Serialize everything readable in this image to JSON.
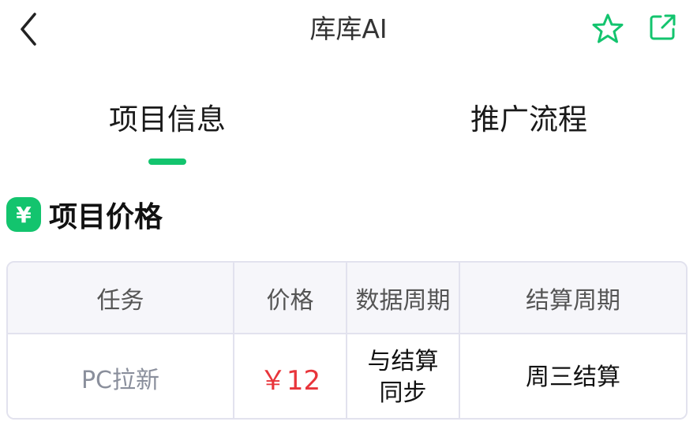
{
  "header": {
    "title": "库库AI",
    "back_icon": "chevron-left-icon",
    "favorite_icon": "star-outline-icon",
    "share_icon": "external-link-icon",
    "accent_color": "#13c46e"
  },
  "tabs": [
    {
      "label": "项目信息",
      "active": true
    },
    {
      "label": "推广流程",
      "active": false
    }
  ],
  "section": {
    "icon": "yen-icon",
    "icon_glyph": "¥",
    "title": "项目价格"
  },
  "table": {
    "headers": [
      "任务",
      "价格",
      "数据周期",
      "结算周期"
    ],
    "rows": [
      {
        "task": "PC拉新",
        "price": "￥12",
        "data_cycle": "与结算同步",
        "settle_cycle": "周三结算"
      }
    ]
  },
  "colors": {
    "price": "#e8353b",
    "table_border": "#e2e2ee",
    "header_bg": "#f6f6fa"
  }
}
